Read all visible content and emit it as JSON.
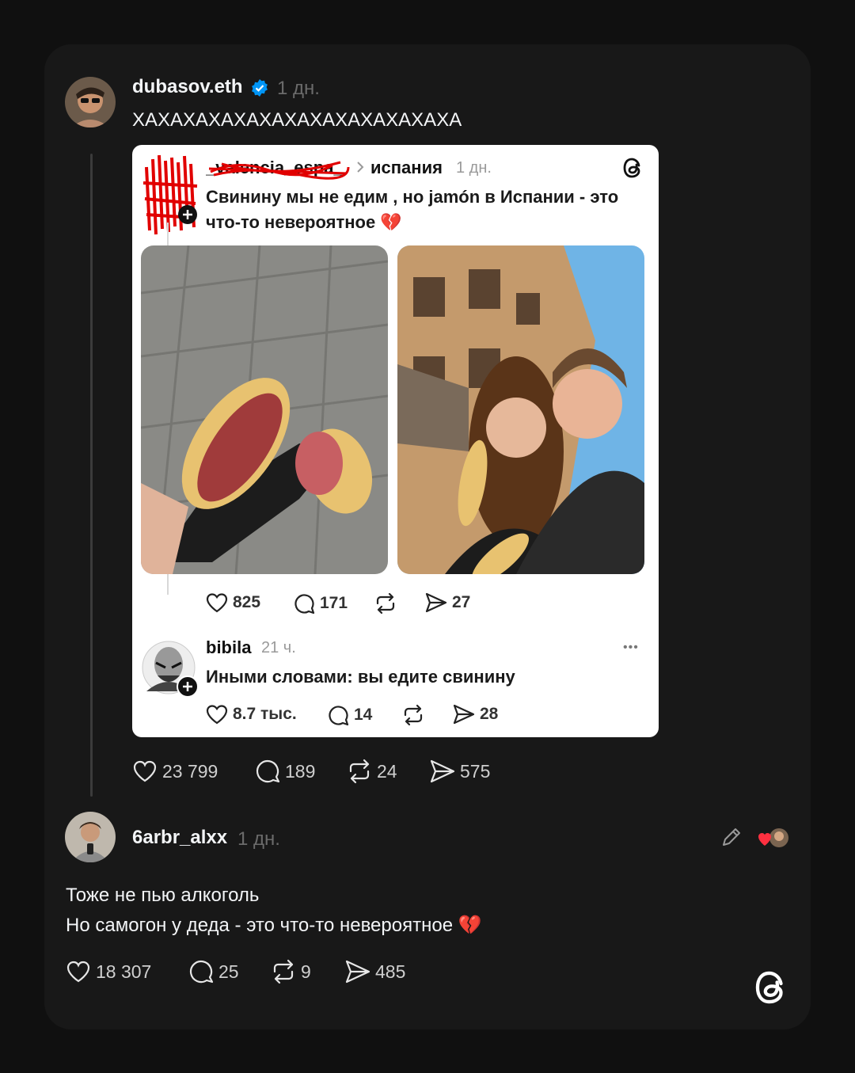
{
  "post": {
    "username": "dubasov.eth",
    "time": "1 дн.",
    "text": "ХАХАХАХАХАХАХАХАХАХАХАХАХА",
    "stats": {
      "likes": "23 799",
      "replies": "189",
      "reposts": "24",
      "shares": "575"
    }
  },
  "quoted": {
    "username": "_valencia_espa_",
    "topic": "испания",
    "time": "1 дн.",
    "text_line1": "Свинину мы не едим , но jamón в Испании - это",
    "text_line2": "что-то невероятное",
    "emoji": "💔",
    "stats": {
      "likes": "825",
      "replies": "171",
      "shares": "27"
    },
    "reply": {
      "username": "bibila",
      "time": "21 ч.",
      "text": "Иными словами: вы едите свинину",
      "more": "•••",
      "stats": {
        "likes": "8.7 тыс.",
        "replies": "14",
        "shares": "28"
      }
    }
  },
  "comment": {
    "username": "6arbr_alxx",
    "time": "1 дн.",
    "text_line1": "Тоже не пью алкоголь",
    "text_line2": "Но самогон у деда - это что-то невероятное",
    "emoji": "💔",
    "stats": {
      "likes": "18 307",
      "replies": "25",
      "reposts": "9",
      "shares": "485"
    }
  },
  "colors": {
    "background": "#101010",
    "card": "#181818",
    "verified": "#0095f6",
    "heart": "#ff3040"
  },
  "icons": [
    "verified-badge-icon",
    "heart-icon",
    "comment-icon",
    "repost-icon",
    "share-icon",
    "threads-logo-icon",
    "pencil-icon",
    "more-icon",
    "plus-icon"
  ]
}
